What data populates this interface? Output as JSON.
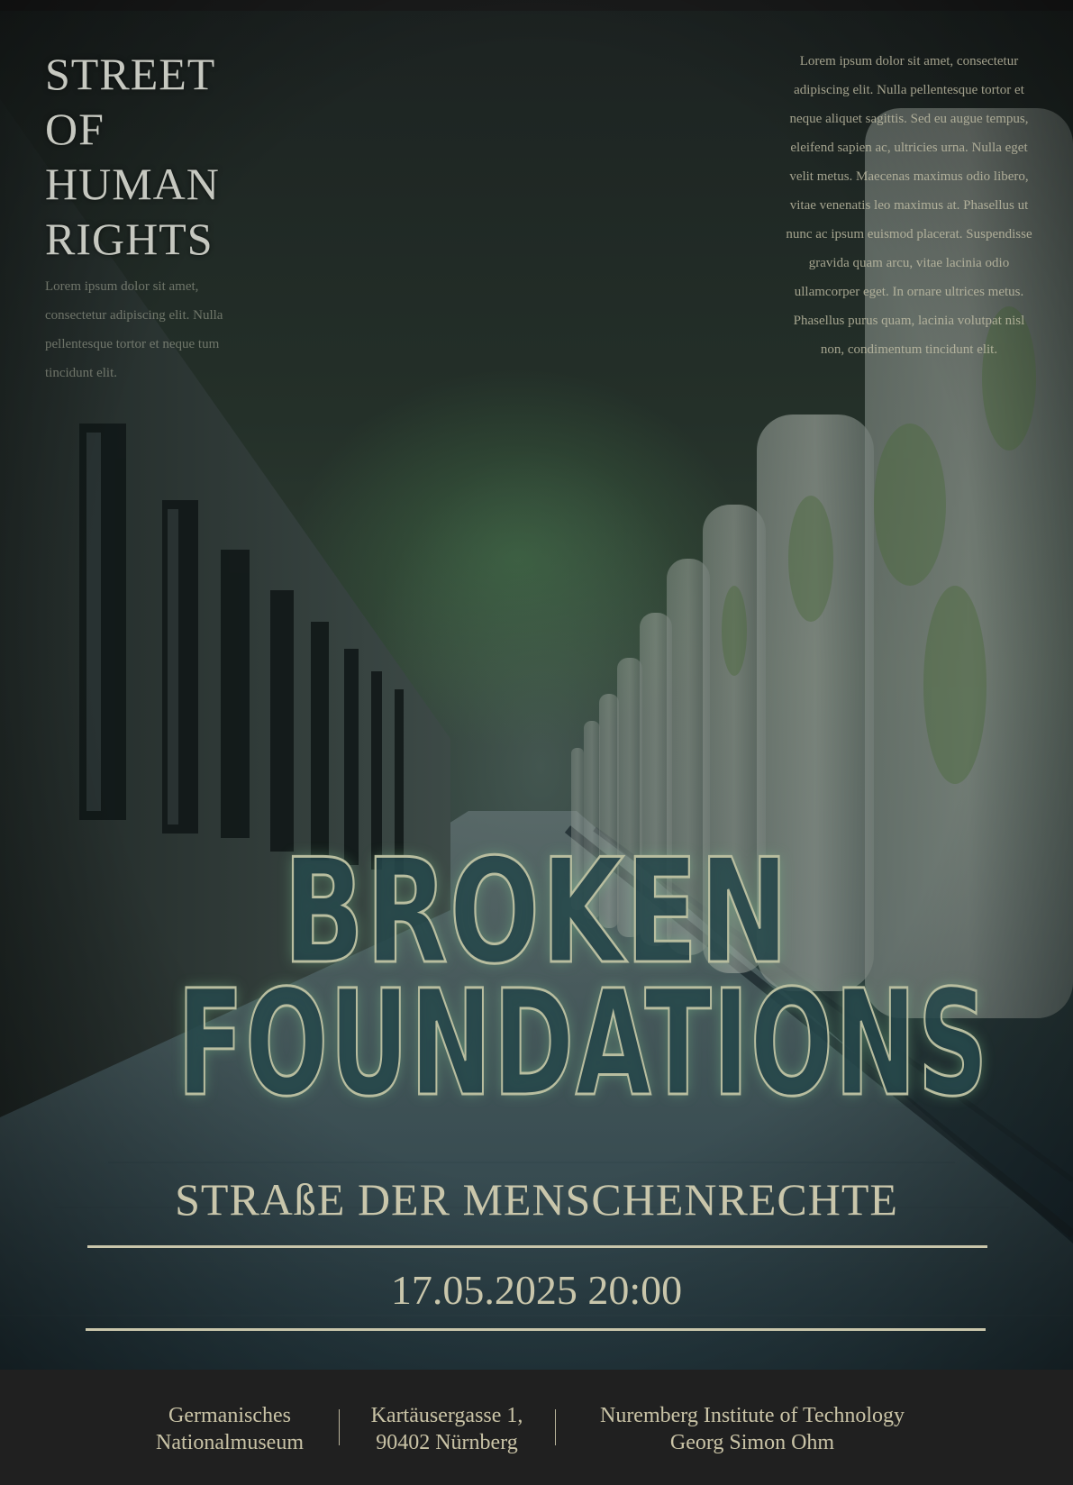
{
  "title": [
    "STREET",
    "OF",
    "HUMAN",
    "RIGHTS"
  ],
  "left_body": "Lorem ipsum dolor sit amet, consectetur adipiscing elit. Nulla pellentesque tortor et neque tum tincidunt elit.",
  "right_body": "Lorem ipsum dolor sit amet, consectetur adipiscing elit. Nulla pellentesque tortor et neque aliquet sagittis. Sed eu augue tempus, eleifend sapien ac, ultricies urna. Nulla eget velit metus. Maecenas maximus odio libero, vitae venenatis leo maximus at. Phasellus ut nunc ac ipsum euismod placerat. Suspendisse gravida quam arcu, vitae lacinia odio ullamcorper eget. In ornare ultrices metus. Phasellus purus quam, lacinia volutpat nisl non, condimentum tincidunt elit.",
  "headline": {
    "line1": "BROKEN",
    "line2": "FOUNDATIONS"
  },
  "subtitle": "STRAßE DER MENSCHENRECHTE",
  "datetime": "17.05.2025 20:00",
  "footer": {
    "venue": [
      "Germanisches",
      "Nationalmuseum"
    ],
    "address": [
      "Kartäusergasse 1,",
      "90402 Nürnberg"
    ],
    "institution": [
      "Nuremberg Institute of Technology",
      "Georg Simon Ohm"
    ]
  },
  "colors": {
    "accent": "#c9c6ab",
    "headline_fill": "#203e46",
    "headline_stroke": "#b8bd9f",
    "footer_bg": "#202020"
  }
}
